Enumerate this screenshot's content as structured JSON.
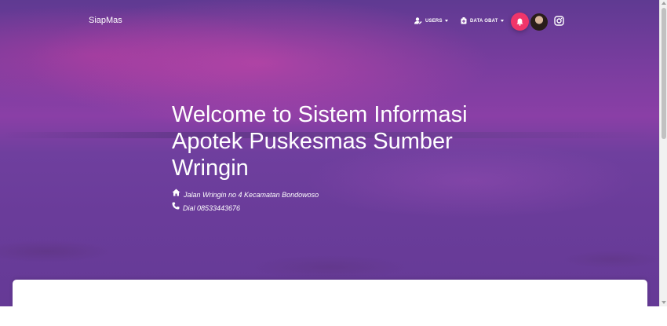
{
  "navbar": {
    "brand": "SiapMas",
    "users_label": "USERS",
    "data_obat_label": "DATA OBAT"
  },
  "hero": {
    "title": "Welcome to Sistem Informasi Apotek Puskesmas Sumber Wringin",
    "address": "Jalan Wringin no 4 Kecamatan Bondowoso",
    "phone": "Dial 08533443676"
  },
  "icons": {
    "users": "user-edit-icon",
    "data_obat": "medical-box-icon",
    "notifications": "bell-icon",
    "instagram": "instagram-icon",
    "address": "home-icon",
    "phone": "phone-icon"
  },
  "colors": {
    "accent_notification": "#f0356a",
    "hero_purple": "#7a3d9f"
  }
}
